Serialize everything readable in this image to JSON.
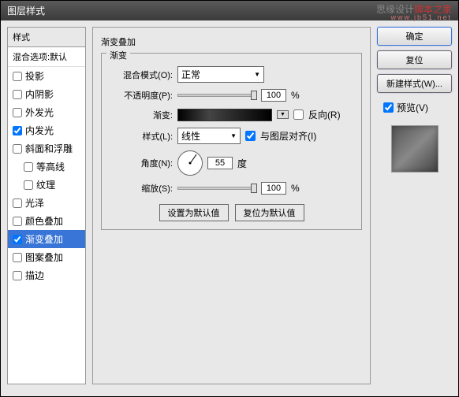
{
  "title": "图层样式",
  "watermark": {
    "t1a": "思缘设计",
    "t1b": "脚本之家",
    "t2": "www.jb51.net"
  },
  "left": {
    "header": "样式",
    "blend": "混合选项:默认",
    "items": [
      {
        "label": "投影",
        "checked": false
      },
      {
        "label": "内阴影",
        "checked": false
      },
      {
        "label": "外发光",
        "checked": false
      },
      {
        "label": "内发光",
        "checked": true
      },
      {
        "label": "斜面和浮雕",
        "checked": false
      },
      {
        "label": "等高线",
        "checked": false,
        "indent": true
      },
      {
        "label": "纹理",
        "checked": false,
        "indent": true
      },
      {
        "label": "光泽",
        "checked": false
      },
      {
        "label": "颜色叠加",
        "checked": false
      },
      {
        "label": "渐变叠加",
        "checked": true,
        "selected": true
      },
      {
        "label": "图案叠加",
        "checked": false
      },
      {
        "label": "描边",
        "checked": false
      }
    ]
  },
  "center": {
    "title": "渐变叠加",
    "fieldset": "渐变",
    "blend_label": "混合模式(O):",
    "blend_value": "正常",
    "opacity_label": "不透明度(P):",
    "opacity_value": "100",
    "pct": "%",
    "gradient_label": "渐变:",
    "reverse": "反向(R)",
    "style_label": "样式(L):",
    "style_value": "线性",
    "align": "与图层对齐(I)",
    "angle_label": "角度(N):",
    "angle_value": "55",
    "deg": "度",
    "scale_label": "缩放(S):",
    "scale_value": "100",
    "btn_default": "设置为默认值",
    "btn_reset": "复位为默认值"
  },
  "right": {
    "ok": "确定",
    "cancel": "复位",
    "newstyle": "新建样式(W)...",
    "preview": "预览(V)"
  }
}
